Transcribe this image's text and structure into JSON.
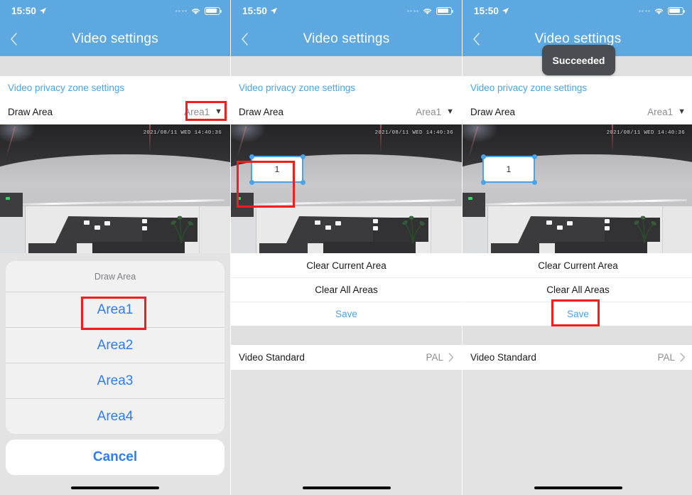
{
  "status_bar": {
    "time": "15:50",
    "location_icon": "location-arrow-icon",
    "signal_icon": "signal-dots-icon",
    "wifi_icon": "wifi-icon",
    "battery_icon": "battery-icon"
  },
  "nav": {
    "title": "Video settings",
    "back_icon": "chevron-left-icon"
  },
  "content": {
    "privacy_link": "Video privacy zone settings",
    "draw_area_label": "Draw Area",
    "draw_area_value": "Area1",
    "dropdown_icon": "caret-down-icon",
    "clear_current": "Clear Current Area",
    "clear_all": "Clear All Areas",
    "save": "Save",
    "video_standard_label": "Video Standard",
    "video_standard_value": "PAL",
    "disclosure_icon": "chevron-right-icon"
  },
  "video": {
    "timestamp": "2021/08/11  WED 14:40:36",
    "zone_number": "1"
  },
  "action_sheet": {
    "title": "Draw Area",
    "options": [
      {
        "label": "Area1"
      },
      {
        "label": "Area2"
      },
      {
        "label": "Area3"
      },
      {
        "label": "Area4"
      }
    ],
    "cancel": "Cancel"
  },
  "toast": {
    "message": "Succeeded"
  },
  "colors": {
    "header_blue": "#5da8e0",
    "link_blue": "#4aa3e8",
    "sheet_blue": "#2f7df6",
    "annotation_red": "#f41d1d",
    "toast_bg": "#4a4d52",
    "page_grey": "#e0e0e0"
  }
}
